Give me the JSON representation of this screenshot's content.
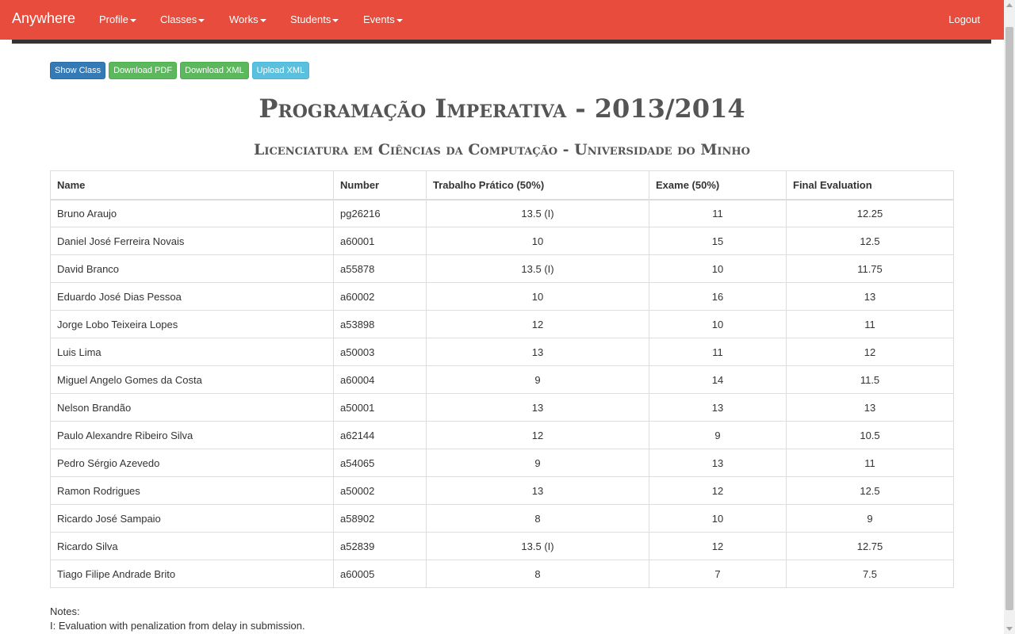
{
  "navbar": {
    "brand": "Anywhere",
    "items": [
      "Profile",
      "Classes",
      "Works",
      "Students",
      "Events"
    ],
    "logout": "Logout",
    "color": "#e74c3c"
  },
  "toolbar": {
    "show_class": "Show Class",
    "download_pdf": "Download PDF",
    "download_xml": "Download XML",
    "upload_xml": "Upload XML"
  },
  "page": {
    "title": "Programação Imperativa - 2013/2014",
    "subtitle": "Licenciatura em Ciências da Computação - Universidade do Minho"
  },
  "table": {
    "headers": [
      "Name",
      "Number",
      "Trabalho Prático (50%)",
      "Exame (50%)",
      "Final Evaluation"
    ],
    "rows": [
      [
        "Bruno Araujo",
        "pg26216",
        "13.5 (I)",
        "11",
        "12.25"
      ],
      [
        "Daniel José Ferreira Novais",
        "a60001",
        "10",
        "15",
        "12.5"
      ],
      [
        "David Branco",
        "a55878",
        "13.5 (I)",
        "10",
        "11.75"
      ],
      [
        "Eduardo José Dias Pessoa",
        "a60002",
        "10",
        "16",
        "13"
      ],
      [
        "Jorge Lobo Teixeira Lopes",
        "a53898",
        "12",
        "10",
        "11"
      ],
      [
        "Luis Lima",
        "a50003",
        "13",
        "11",
        "12"
      ],
      [
        "Miguel Angelo Gomes da Costa",
        "a60004",
        "9",
        "14",
        "11.5"
      ],
      [
        "Nelson Brandão",
        "a50001",
        "13",
        "13",
        "13"
      ],
      [
        "Paulo Alexandre Ribeiro Silva",
        "a62144",
        "12",
        "9",
        "10.5"
      ],
      [
        "Pedro Sérgio Azevedo",
        "a54065",
        "9",
        "13",
        "11"
      ],
      [
        "Ramon Rodrigues",
        "a50002",
        "13",
        "12",
        "12.5"
      ],
      [
        "Ricardo José Sampaio",
        "a58902",
        "8",
        "10",
        "9"
      ],
      [
        "Ricardo Silva",
        "a52839",
        "13.5 (I)",
        "12",
        "12.75"
      ],
      [
        "Tiago Filipe Andrade Brito",
        "a60005",
        "8",
        "7",
        "7.5"
      ]
    ]
  },
  "notes": {
    "label": "Notes:",
    "items": [
      "I: Evaluation with penalization from delay in submission."
    ]
  }
}
